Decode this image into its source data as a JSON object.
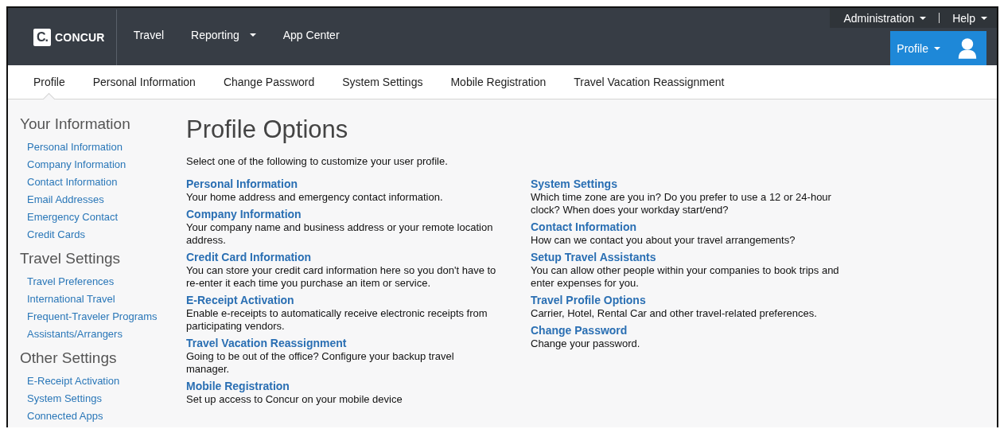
{
  "header": {
    "logo": {
      "mark": "C.",
      "name": "CONCUR"
    },
    "nav": [
      {
        "label": "Travel",
        "dropdown": false
      },
      {
        "label": "Reporting",
        "dropdown": true
      },
      {
        "label": "App Center",
        "dropdown": false
      }
    ],
    "utility": [
      {
        "label": "Administration",
        "dropdown": true
      },
      {
        "label": "Help",
        "dropdown": true
      }
    ],
    "profile_button": {
      "label": "Profile",
      "dropdown": true
    }
  },
  "tabs": [
    {
      "label": "Profile",
      "selected": true
    },
    {
      "label": "Personal Information",
      "selected": false
    },
    {
      "label": "Change Password",
      "selected": false
    },
    {
      "label": "System Settings",
      "selected": false
    },
    {
      "label": "Mobile Registration",
      "selected": false
    },
    {
      "label": "Travel Vacation Reassignment",
      "selected": false
    }
  ],
  "sidebar": [
    {
      "heading": "Your Information",
      "items": [
        "Personal Information",
        "Company Information",
        "Contact Information",
        "Email Addresses",
        "Emergency Contact",
        "Credit Cards"
      ]
    },
    {
      "heading": "Travel Settings",
      "items": [
        "Travel Preferences",
        "International Travel",
        "Frequent-Traveler Programs",
        "Assistants/Arrangers"
      ]
    },
    {
      "heading": "Other Settings",
      "items": [
        "E-Receipt Activation",
        "System Settings",
        "Connected Apps"
      ]
    }
  ],
  "main": {
    "title": "Profile Options",
    "intro": "Select one of the following to customize your user profile.",
    "columns": [
      [
        {
          "title": "Personal Information",
          "description": "Your home address and emergency contact information."
        },
        {
          "title": "Company Information",
          "description": "Your company name and business address or your remote location address."
        },
        {
          "title": "Credit Card Information",
          "description": "You can store your credit card information here so you don't have to re-enter it each time you purchase an item or service."
        },
        {
          "title": "E-Receipt Activation",
          "description": "Enable e-receipts to automatically receive electronic receipts from participating vendors."
        },
        {
          "title": "Travel Vacation Reassignment",
          "description": "Going to be out of the office? Configure your backup travel manager."
        },
        {
          "title": "Mobile Registration",
          "description": "Set up access to Concur on your mobile device"
        }
      ],
      [
        {
          "title": "System Settings",
          "description": "Which time zone are you in? Do you prefer to use a 12 or 24-hour clock? When does your workday start/end?"
        },
        {
          "title": "Contact Information",
          "description": "How can we contact you about your travel arrangements?"
        },
        {
          "title": "Setup Travel Assistants",
          "description": "You can allow other people within your companies to book trips and enter expenses for you."
        },
        {
          "title": "Travel Profile Options",
          "description": "Carrier, Hotel, Rental Car and other travel-related preferences."
        },
        {
          "title": "Change Password",
          "description": "Change your password."
        }
      ]
    ]
  }
}
